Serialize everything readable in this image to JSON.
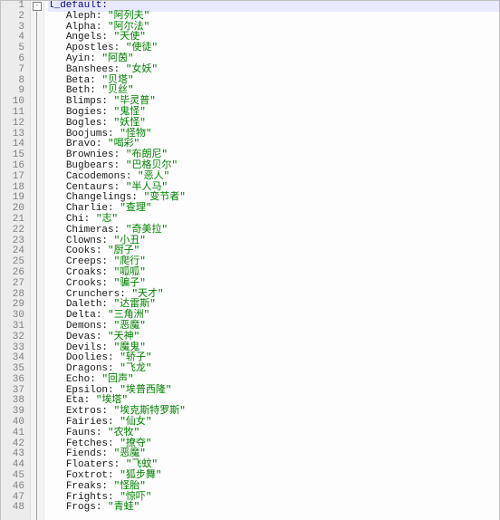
{
  "root_key": "l_default:",
  "highlight_line": 1,
  "entries": [
    {
      "key": "Aleph",
      "value": "阿列夫"
    },
    {
      "key": "Alpha",
      "value": "阿尔法"
    },
    {
      "key": "Angels",
      "value": "天使"
    },
    {
      "key": "Apostles",
      "value": "使徒"
    },
    {
      "key": "Ayin",
      "value": "阿茵"
    },
    {
      "key": "Banshees",
      "value": "女妖"
    },
    {
      "key": "Beta",
      "value": "贝塔"
    },
    {
      "key": "Beth",
      "value": "贝丝"
    },
    {
      "key": "Blimps",
      "value": "毕灵普"
    },
    {
      "key": "Bogies",
      "value": "鬼怪"
    },
    {
      "key": "Bogles",
      "value": "妖怪"
    },
    {
      "key": "Boojums",
      "value": "怪物"
    },
    {
      "key": "Bravo",
      "value": "喝彩"
    },
    {
      "key": "Brownies",
      "value": "布朗尼"
    },
    {
      "key": "Bugbears",
      "value": "巴格贝尔"
    },
    {
      "key": "Cacodemons",
      "value": "恶人"
    },
    {
      "key": "Centaurs",
      "value": "半人马"
    },
    {
      "key": "Changelings",
      "value": "变节者"
    },
    {
      "key": "Charlie",
      "value": "查理"
    },
    {
      "key": "Chi",
      "value": "志"
    },
    {
      "key": "Chimeras",
      "value": "奇美拉"
    },
    {
      "key": "Clowns",
      "value": "小丑"
    },
    {
      "key": "Cooks",
      "value": "厨子"
    },
    {
      "key": "Creeps",
      "value": "爬行"
    },
    {
      "key": "Croaks",
      "value": "呱呱"
    },
    {
      "key": "Crooks",
      "value": "骗子"
    },
    {
      "key": "Crunchers",
      "value": "天才"
    },
    {
      "key": "Daleth",
      "value": "达雷斯"
    },
    {
      "key": "Delta",
      "value": "三角洲"
    },
    {
      "key": "Demons",
      "value": "恶魔"
    },
    {
      "key": "Devas",
      "value": "天神"
    },
    {
      "key": "Devils",
      "value": "魔鬼"
    },
    {
      "key": "Doolies",
      "value": "轿子"
    },
    {
      "key": "Dragons",
      "value": "飞龙"
    },
    {
      "key": "Echo",
      "value": "回声"
    },
    {
      "key": "Epsilon",
      "value": "埃普西隆"
    },
    {
      "key": "Eta",
      "value": "埃塔"
    },
    {
      "key": "Extros",
      "value": "埃克斯特罗斯"
    },
    {
      "key": "Fairies",
      "value": "仙女"
    },
    {
      "key": "Fauns",
      "value": "农牧"
    },
    {
      "key": "Fetches",
      "value": "撩夺"
    },
    {
      "key": "Fiends",
      "value": "恶魔"
    },
    {
      "key": "Floaters",
      "value": "飞蚊"
    },
    {
      "key": "Foxtrot",
      "value": "狐步舞"
    },
    {
      "key": "Freaks",
      "value": "怪胎"
    },
    {
      "key": "Frights",
      "value": "惊吓"
    },
    {
      "key": "Frogs",
      "value": "青蛙"
    }
  ]
}
